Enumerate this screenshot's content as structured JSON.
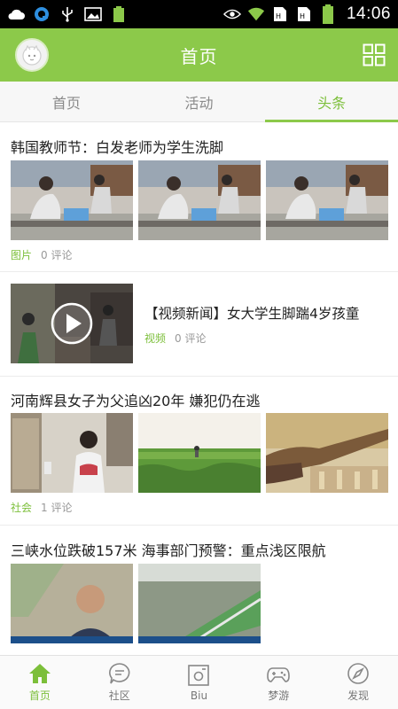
{
  "status_bar": {
    "time": "14:06",
    "left_icons": [
      "cloud-icon",
      "q-app-icon",
      "usb-icon",
      "image-icon",
      "battery-small-icon"
    ],
    "right_icons": [
      "eye-icon",
      "wifi-icon",
      "sim-icon",
      "sim-icon",
      "battery-icon"
    ]
  },
  "header": {
    "title": "首页"
  },
  "tabs": [
    {
      "label": "首页",
      "active": false
    },
    {
      "label": "活动",
      "active": false
    },
    {
      "label": "头条",
      "active": true
    }
  ],
  "feed": [
    {
      "title": "韩国教师节：白发老师为学生洗脚",
      "category": "图片",
      "comments": "0  评论"
    },
    {
      "title": "【视频新闻】女大学生脚踹4岁孩童",
      "category": "视频",
      "comments": "0  评论"
    },
    {
      "title": "河南辉县女子为父追凶20年 嫌犯仍在逃",
      "category": "社会",
      "comments": "1  评论"
    },
    {
      "title": "三峡水位跌破157米 海事部门预警：重点浅区限航"
    }
  ],
  "bottom_nav": [
    {
      "label": "首页",
      "icon": "home-icon",
      "active": true
    },
    {
      "label": "社区",
      "icon": "chat-bubble-icon",
      "active": false
    },
    {
      "label": "Biu",
      "icon": "camera-frame-icon",
      "active": false
    },
    {
      "label": "梦游",
      "icon": "gamepad-icon",
      "active": false
    },
    {
      "label": "发现",
      "icon": "compass-icon",
      "active": false
    }
  ],
  "colors": {
    "accent": "#8cc94a",
    "accent_text": "#7cbf3a"
  }
}
